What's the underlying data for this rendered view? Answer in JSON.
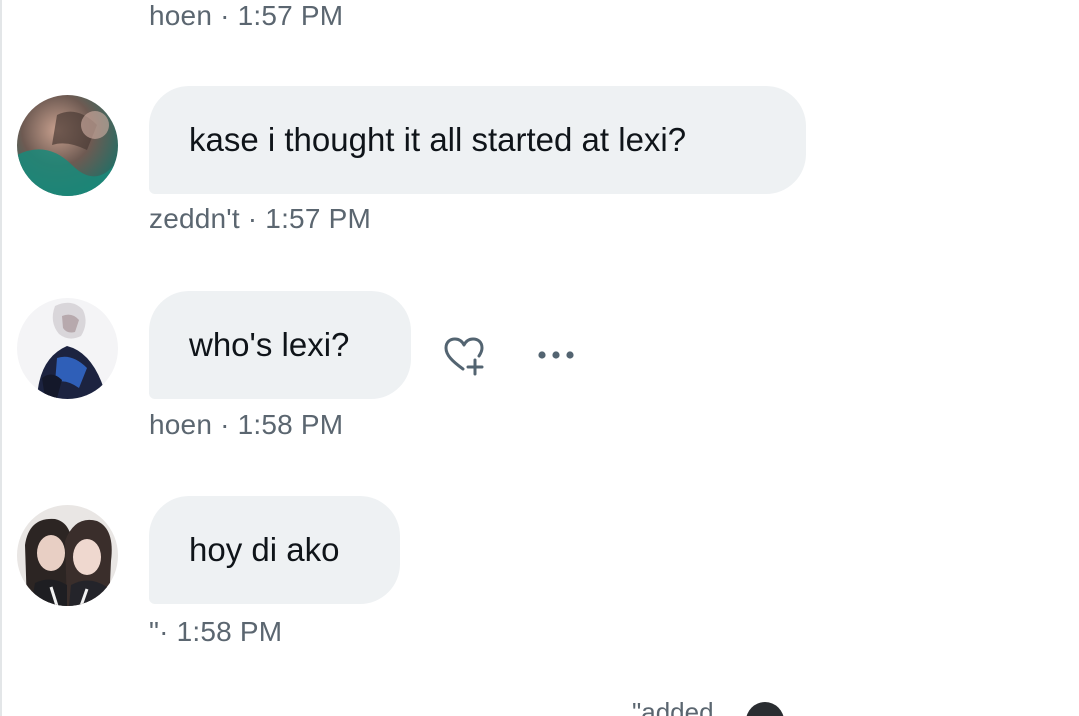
{
  "messages": [
    {
      "meta": "hoen · 1:57 PM"
    },
    {
      "text": "kase i thought it all started at lexi?",
      "meta": "zeddn't · 1:57 PM"
    },
    {
      "text": "who's lexi?",
      "meta": "hoen · 1:58 PM"
    },
    {
      "text": "hoy di ako",
      "meta": "\"· 1:58 PM"
    }
  ],
  "footer": {
    "text": "\"added"
  },
  "icons": {
    "react": "heart-plus-icon",
    "more": "more-horizontal-icon"
  },
  "colors": {
    "bubble": "#eef1f3",
    "meta_text": "#5b6670",
    "message_text": "#0f1419"
  }
}
